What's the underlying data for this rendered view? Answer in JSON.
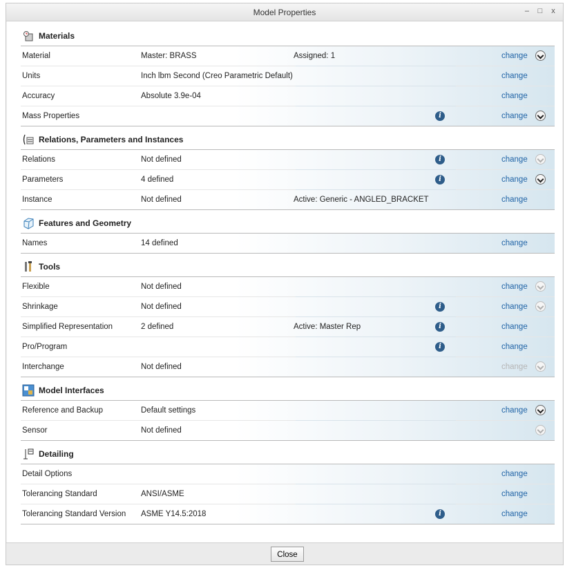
{
  "window": {
    "title": "Model Properties",
    "controls": {
      "minimize": "–",
      "maximize": "□",
      "close": "x"
    }
  },
  "sections": [
    {
      "title": "Materials",
      "icon": "materials-icon",
      "rows": [
        {
          "name": "Material",
          "value": "Master: BRASS",
          "extra": "Assigned: 1",
          "info": false,
          "change": "change",
          "change_enabled": true,
          "expander": "enabled"
        },
        {
          "name": "Units",
          "value": "Inch lbm Second (Creo Parametric Default)",
          "extra": "",
          "info": false,
          "change": "change",
          "change_enabled": true,
          "expander": "none"
        },
        {
          "name": "Accuracy",
          "value": "Absolute 3.9e-04",
          "extra": "",
          "info": false,
          "change": "change",
          "change_enabled": true,
          "expander": "none"
        },
        {
          "name": "Mass Properties",
          "value": "",
          "extra": "",
          "info": true,
          "change": "change",
          "change_enabled": true,
          "expander": "enabled"
        }
      ]
    },
    {
      "title": "Relations, Parameters and Instances",
      "icon": "relations-icon",
      "rows": [
        {
          "name": "Relations",
          "value": "Not defined",
          "extra": "",
          "info": true,
          "change": "change",
          "change_enabled": true,
          "expander": "disabled"
        },
        {
          "name": "Parameters",
          "value": "4 defined",
          "extra": "",
          "info": true,
          "change": "change",
          "change_enabled": true,
          "expander": "enabled"
        },
        {
          "name": "Instance",
          "value": "Not defined",
          "extra": "Active: Generic - ANGLED_BRACKET",
          "info": false,
          "change": "change",
          "change_enabled": true,
          "expander": "none"
        }
      ]
    },
    {
      "title": "Features and Geometry",
      "icon": "features-icon",
      "rows": [
        {
          "name": "Names",
          "value": "14 defined",
          "extra": "",
          "info": false,
          "change": "change",
          "change_enabled": true,
          "expander": "none"
        }
      ]
    },
    {
      "title": "Tools",
      "icon": "tools-icon",
      "rows": [
        {
          "name": "Flexible",
          "value": "Not defined",
          "extra": "",
          "info": false,
          "change": "change",
          "change_enabled": true,
          "expander": "disabled"
        },
        {
          "name": "Shrinkage",
          "value": "Not defined",
          "extra": "",
          "info": true,
          "change": "change",
          "change_enabled": true,
          "expander": "disabled"
        },
        {
          "name": "Simplified Representation",
          "value": "2 defined",
          "extra": "Active: Master Rep",
          "info": true,
          "change": "change",
          "change_enabled": true,
          "expander": "none"
        },
        {
          "name": "Pro/Program",
          "value": "",
          "extra": "",
          "info": true,
          "change": "change",
          "change_enabled": true,
          "expander": "none"
        },
        {
          "name": "Interchange",
          "value": "Not defined",
          "extra": "",
          "info": false,
          "change": "change",
          "change_enabled": false,
          "expander": "disabled"
        }
      ]
    },
    {
      "title": "Model Interfaces",
      "icon": "model-interfaces-icon",
      "rows": [
        {
          "name": "Reference and Backup",
          "value": "Default settings",
          "extra": "",
          "info": false,
          "change": "change",
          "change_enabled": true,
          "expander": "enabled"
        },
        {
          "name": "Sensor",
          "value": "Not defined",
          "extra": "",
          "info": false,
          "change": "",
          "change_enabled": false,
          "expander": "disabled"
        }
      ]
    },
    {
      "title": "Detailing",
      "icon": "detailing-icon",
      "rows": [
        {
          "name": "Detail Options",
          "value": "",
          "extra": "",
          "info": false,
          "change": "change",
          "change_enabled": true,
          "expander": "none"
        },
        {
          "name": "Tolerancing Standard",
          "value": "ANSI/ASME",
          "extra": "",
          "info": false,
          "change": "change",
          "change_enabled": true,
          "expander": "none"
        },
        {
          "name": "Tolerancing Standard Version",
          "value": "ASME Y14.5:2018",
          "extra": "",
          "info": true,
          "change": "change",
          "change_enabled": true,
          "expander": "none"
        }
      ]
    }
  ],
  "footer": {
    "close_label": "Close"
  },
  "colors": {
    "link": "#1f63a6",
    "info_icon": "#2e5d8a",
    "row_gradient_end": "#d6e6ef"
  }
}
